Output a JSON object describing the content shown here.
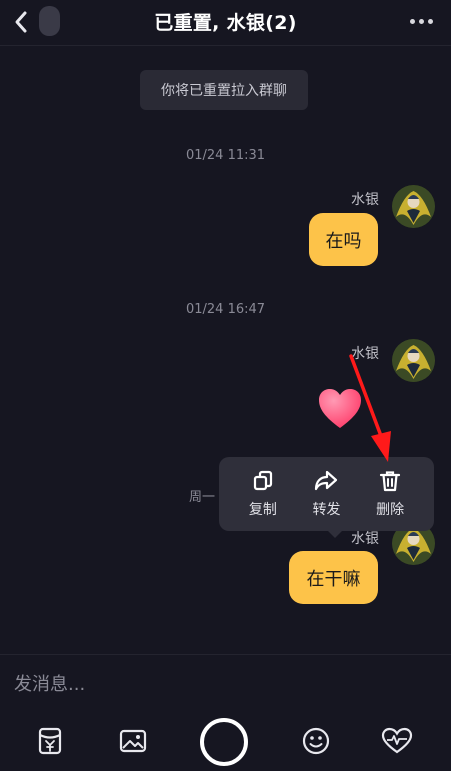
{
  "header": {
    "title": "已重置, 水银(2)",
    "back_icon": "chevron-left-icon",
    "more_icon": "more-dots-icon"
  },
  "messages": {
    "system_notice": "你将已重置拉入群聊",
    "timestamp_1": "01/24 11:31",
    "sender_1": "水银",
    "message_1": "在吗",
    "timestamp_2": "01/24 16:47",
    "sender_2": "水银",
    "sticker_icon": "heart-icon",
    "week_label": "周一",
    "sender_3": "水银",
    "message_3": "在干嘛"
  },
  "context_menu": {
    "copy_label": "复制",
    "forward_label": "转发",
    "delete_label": "删除"
  },
  "composer": {
    "placeholder": "发消息..."
  },
  "toolbar": {
    "icons": [
      "red-packet-icon",
      "image-icon",
      "record-button",
      "emoji-icon",
      "heart-wave-icon"
    ]
  },
  "colors": {
    "background": "#161621",
    "bubble": "#fdc349",
    "menu": "#2f2f3a",
    "arrow": "#ff1a1a",
    "heart": "#ff4f7b"
  }
}
